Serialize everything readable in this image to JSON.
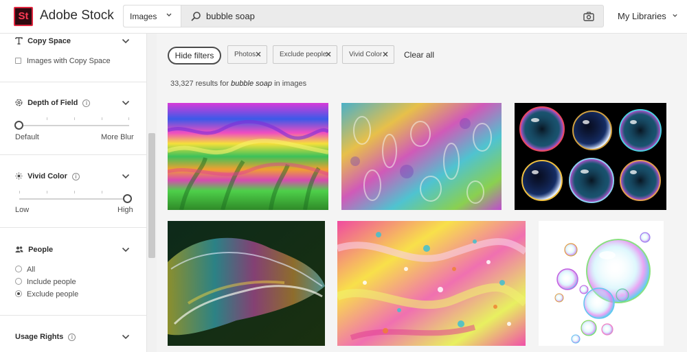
{
  "header": {
    "logo_text": "St",
    "brand": "Adobe Stock",
    "search_scope": "Images",
    "search_query": "bubble soap",
    "libraries_label": "My Libraries"
  },
  "sidebar": {
    "copy_space": {
      "title": "Copy Space",
      "option": "Images with Copy Space"
    },
    "depth_of_field": {
      "title": "Depth of Field",
      "min_label": "Default",
      "max_label": "More Blur",
      "value": 0
    },
    "vivid_color": {
      "title": "Vivid Color",
      "min_label": "Low",
      "max_label": "High",
      "value": 1
    },
    "people": {
      "title": "People",
      "options": [
        "All",
        "Include people",
        "Exclude people"
      ],
      "selected": "Exclude people"
    },
    "usage_rights": {
      "title": "Usage Rights"
    }
  },
  "filters": {
    "hide_label": "Hide filters",
    "chips": [
      "Photos",
      "Exclude people",
      "Vivid Color"
    ],
    "clear_label": "Clear all"
  },
  "results": {
    "count": "33,327",
    "text_before": "results for",
    "query": "bubble soap",
    "text_after": "in images"
  },
  "images": [
    "rainbow-soap-film-swirl",
    "soap-film-iridescent-drips",
    "six-soap-bubbles-on-black",
    "soap-bubble-in-flight",
    "pink-yellow-fluid-texture",
    "soap-bubble-cluster-on-white"
  ],
  "colors": {
    "logo_red": "#ff3b55",
    "logo_bg": "#2f0a10",
    "sidebar_bg": "#ffffff",
    "page_bg": "#f4f4f4"
  }
}
